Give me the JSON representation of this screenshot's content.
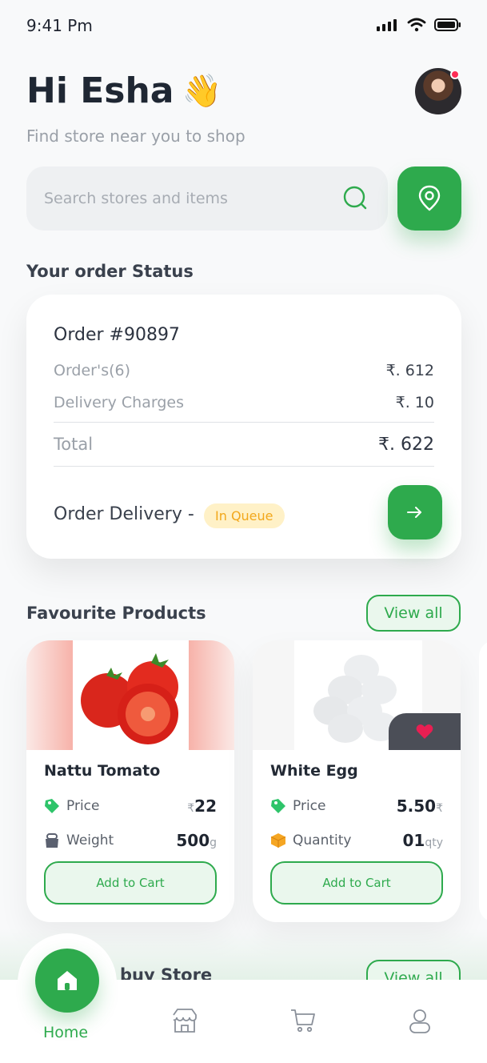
{
  "status_bar": {
    "time": "9:41 Pm"
  },
  "header": {
    "greeting": "Hi Esha",
    "wave": "👋",
    "subtitle": "Find store near you to shop"
  },
  "search": {
    "placeholder": "Search stores and items"
  },
  "order_status": {
    "section_title": "Your order Status",
    "order_number": "Order #90897",
    "rows": [
      {
        "label": "Order's(6)",
        "value": "₹. 612"
      },
      {
        "label": "Delivery Charges",
        "value": "₹. 10"
      }
    ],
    "total": {
      "label": "Total",
      "value": "₹. 622"
    },
    "delivery_label": "Order Delivery -",
    "delivery_status": "In Queue"
  },
  "favourites": {
    "section_title": "Favourite Products",
    "view_all": "View all",
    "products": [
      {
        "name": "Nattu Tomato",
        "row1_label": "Price",
        "row1_currency": "₹",
        "row1_value": "22",
        "row2_label": "Weight",
        "row2_value": "500",
        "row2_unit": "g",
        "cart_label": "Add to Cart"
      },
      {
        "name": "White Egg",
        "row1_label": "Price",
        "row1_value": "5.50",
        "row1_currency": "₹",
        "row2_label": "Quantity",
        "row2_value": "01",
        "row2_unit": "qty",
        "cart_label": "Add to Cart"
      }
    ]
  },
  "buy_section": {
    "title_partial": "buy Store",
    "view_all": "View all"
  },
  "bottom_nav": {
    "home_label": "Home"
  },
  "colors": {
    "accent": "#2eaa4d",
    "badge_bg": "#fff1c7",
    "badge_text": "#f2a71b",
    "notification": "#ff2d55"
  }
}
